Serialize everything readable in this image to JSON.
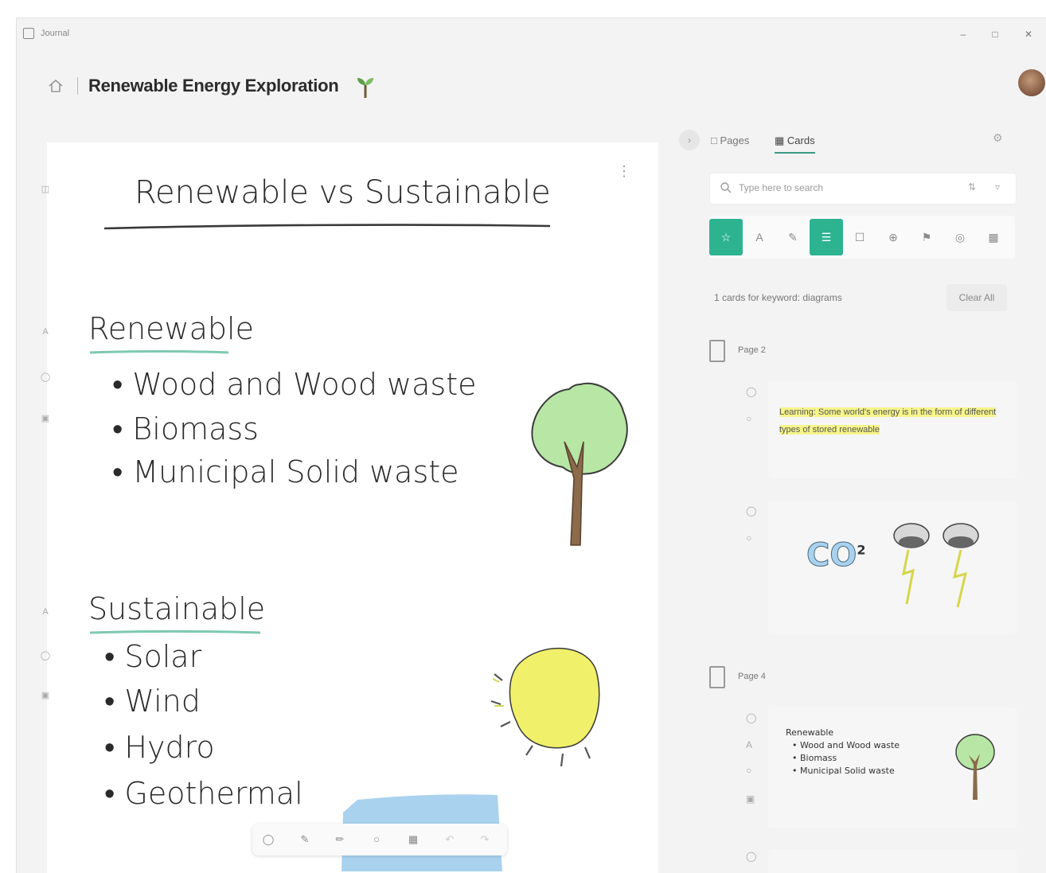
{
  "window": {
    "app_name": "Journal"
  },
  "header": {
    "title": "Renewable Energy Exploration"
  },
  "canvas": {
    "heading": "Renewable vs Sustainable",
    "renewable": {
      "title": "Renewable",
      "items": [
        "• Wood and Wood waste",
        "• Biomass",
        "• Municipal Solid waste"
      ]
    },
    "sustainable": {
      "title": "Sustainable",
      "items": [
        "• Solar",
        "• Wind",
        "• Hydro",
        "• Geothermal"
      ]
    }
  },
  "panel": {
    "tabs": [
      {
        "label": "Pages"
      },
      {
        "label": "Cards"
      }
    ],
    "search": {
      "placeholder": "Type here to search"
    },
    "filters": [
      "☆",
      "A",
      "✎",
      "☰",
      "☐",
      "⊕",
      "⚑",
      "◎",
      "▦"
    ],
    "filter_status": "1 cards for keyword: diagrams",
    "clear_label": "Clear All",
    "pages": [
      {
        "label": "Page 2"
      },
      {
        "label": "Page 4"
      }
    ],
    "card1_text": "Learning: Some world's energy is in the form of different types of stored renewable",
    "card3": {
      "title": "Renewable",
      "items": [
        "• Wood and Wood waste",
        "• Biomass",
        "• Municipal Solid waste"
      ]
    },
    "co2_label": "CO",
    "co2_sub": "2"
  },
  "colors": {
    "accent": "#2eb391",
    "tree_leaf": "#b8e6a5",
    "tree_trunk": "#8b6b4a",
    "sun": "#f0f06a",
    "highlight": "#f6f58a",
    "ink_blue": "#a9d2ee"
  }
}
